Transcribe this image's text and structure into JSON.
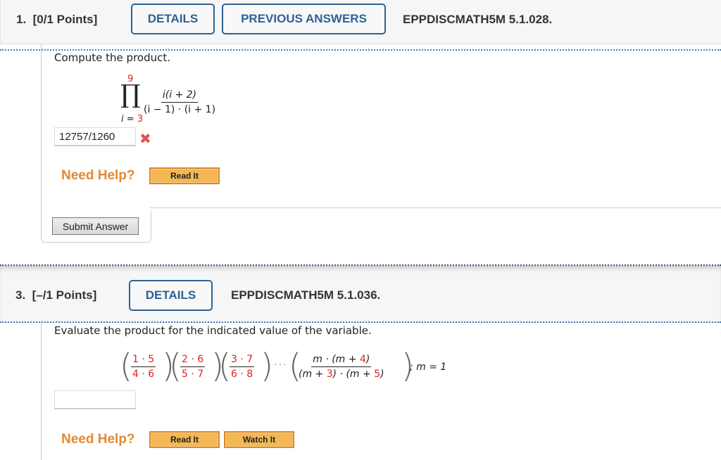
{
  "question1": {
    "number": "1.",
    "points": "[0/1 Points]",
    "details_label": "DETAILS",
    "previous_answers_label": "PREVIOUS ANSWERS",
    "code": "EPPDISCMATH5M 5.1.028.",
    "prompt": "Compute the product.",
    "formula": {
      "upper": "9",
      "lower_var": "i",
      "lower_eq": " = ",
      "lower_val": "3",
      "numerator": "i(i + 2)",
      "denominator": "(i − 1) · (i + 1)"
    },
    "answer_value": "12757/1260",
    "answer_status": "incorrect",
    "need_help": "Need Help?",
    "read_it": "Read It",
    "submit_label": "Submit Answer"
  },
  "question3": {
    "number": "3.",
    "points": "[–/1 Points]",
    "details_label": "DETAILS",
    "code": "EPPDISCMATH5M 5.1.036.",
    "prompt": "Evaluate the product for the indicated value of the variable.",
    "factors": [
      {
        "num": "1 · 5",
        "den": "4 · 6"
      },
      {
        "num": "2 · 6",
        "den": "5 · 7"
      },
      {
        "num": "3 · 7",
        "den": "6 · 8"
      }
    ],
    "ellipsis": "· · ·",
    "general": {
      "num_pre": "m · (m + ",
      "num_red": "4",
      "num_post": ")",
      "den_a": "(m + ",
      "den_a_red": "3",
      "den_mid": ") · (m + ",
      "den_b_red": "5",
      "den_post": ")"
    },
    "condition": "; m = 1",
    "answer_value": "",
    "need_help": "Need Help?",
    "read_it": "Read It",
    "watch_it": "Watch It"
  },
  "colors": {
    "accent_blue": "#2e6194",
    "help_orange": "#e08a34",
    "highlight_red": "#d22"
  }
}
